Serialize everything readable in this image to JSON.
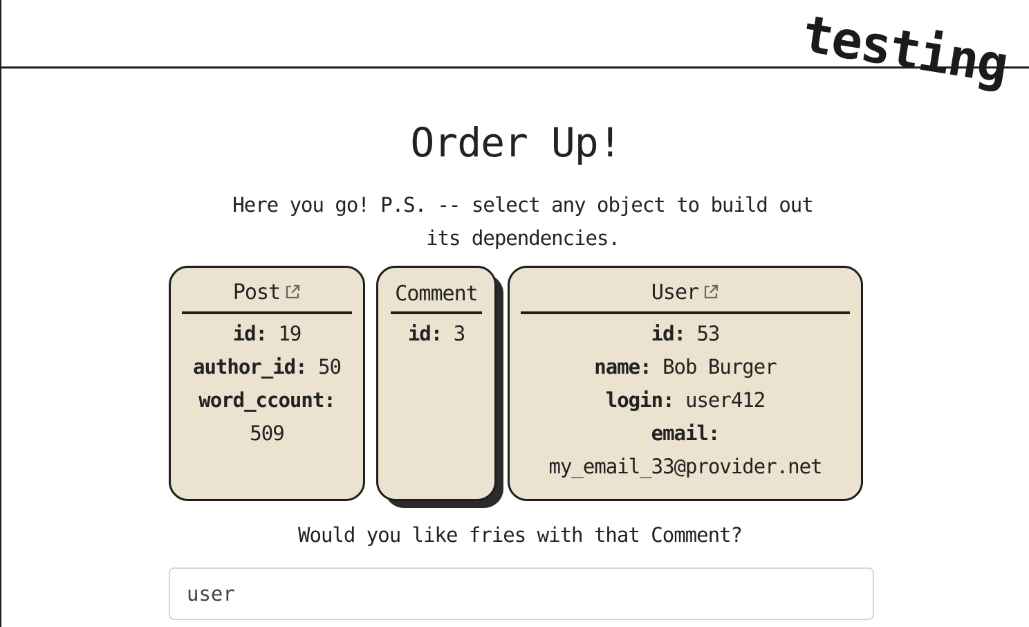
{
  "header": {
    "brand": "testing"
  },
  "main": {
    "title": "Order Up!",
    "subtitle": "Here you go! P.S. -- select any object to build out its dependencies.",
    "question": "Would you like fries with that Comment?",
    "search": {
      "value": "user",
      "placeholder": ""
    }
  },
  "cards": {
    "post": {
      "title": "Post",
      "icon": "external-link-icon",
      "fields": [
        {
          "key": "id:",
          "value": "19"
        },
        {
          "key": "author_id:",
          "value": "50"
        },
        {
          "key": "word_ccount:",
          "value": "509"
        }
      ]
    },
    "comment": {
      "title": "Comment",
      "selected": true,
      "fields": [
        {
          "key": "id:",
          "value": "3"
        }
      ]
    },
    "user": {
      "title": "User",
      "icon": "external-link-icon",
      "fields": [
        {
          "key": "id:",
          "value": "53"
        },
        {
          "key": "name:",
          "value": "Bob Burger"
        },
        {
          "key": "login:",
          "value": "user412"
        },
        {
          "key": "email:",
          "value": "my_email_33@provider.net"
        }
      ]
    }
  },
  "colors": {
    "card_bg": "#ebe3cf",
    "ink": "#1e1e1e"
  }
}
